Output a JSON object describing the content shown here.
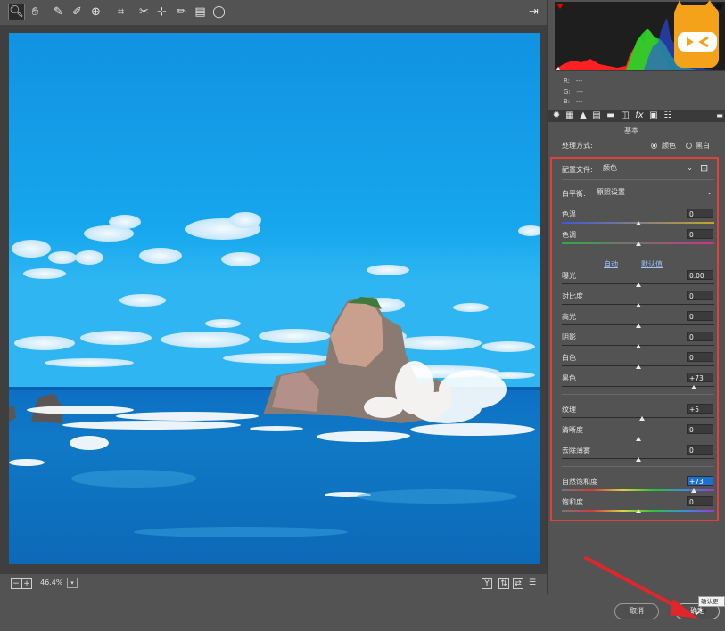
{
  "toolbar": {
    "tools": [
      "zoom-icon",
      "hand-icon",
      "eyedropper-icon",
      "color-sampler-icon",
      "target-adjust-icon",
      "crop-icon",
      "spot-removal-icon",
      "red-eye-icon",
      "brush-icon",
      "gradient-icon",
      "radial-icon"
    ],
    "export_icon": "export-icon"
  },
  "image_bar": {
    "zoom": "46.4%",
    "minus": "−",
    "plus": "+"
  },
  "histogram": {
    "r_label": "R:",
    "g_label": "G:",
    "b_label": "B:",
    "r_val": "---",
    "g_val": "---",
    "b_val": "---"
  },
  "panel": {
    "section_title": "基本",
    "treatment_label": "处理方式:",
    "treatment_color": "颜色",
    "treatment_bw": "黑白",
    "profile_label": "配置文件:",
    "profile_value": "颜色",
    "wb_label": "白平衡:",
    "wb_value": "原照设置",
    "auto": "自动",
    "default": "默认值",
    "sliders": [
      {
        "label": "色温",
        "value": "0",
        "pos": 0.5
      },
      {
        "label": "色调",
        "value": "0",
        "pos": 0.5
      },
      {
        "label": "曝光",
        "value": "0.00",
        "pos": 0.5
      },
      {
        "label": "对比度",
        "value": "0",
        "pos": 0.5
      },
      {
        "label": "高光",
        "value": "0",
        "pos": 0.5
      },
      {
        "label": "阴影",
        "value": "0",
        "pos": 0.5
      },
      {
        "label": "白色",
        "value": "0",
        "pos": 0.5
      },
      {
        "label": "黑色",
        "value": "+73",
        "pos": 0.865
      },
      {
        "label": "纹理",
        "value": "+5",
        "pos": 0.525
      },
      {
        "label": "清晰度",
        "value": "0",
        "pos": 0.5
      },
      {
        "label": "去除薄雾",
        "value": "0",
        "pos": 0.5
      },
      {
        "label": "自然饱和度",
        "value": "+73",
        "pos": 0.865
      },
      {
        "label": "饱和度",
        "value": "0",
        "pos": 0.5
      }
    ]
  },
  "footer": {
    "cancel": "取消",
    "ok": "确定",
    "tooltip": "确认更改"
  },
  "colors": {
    "accent": "#1f6fd1",
    "highlight_box": "#e0403a"
  }
}
